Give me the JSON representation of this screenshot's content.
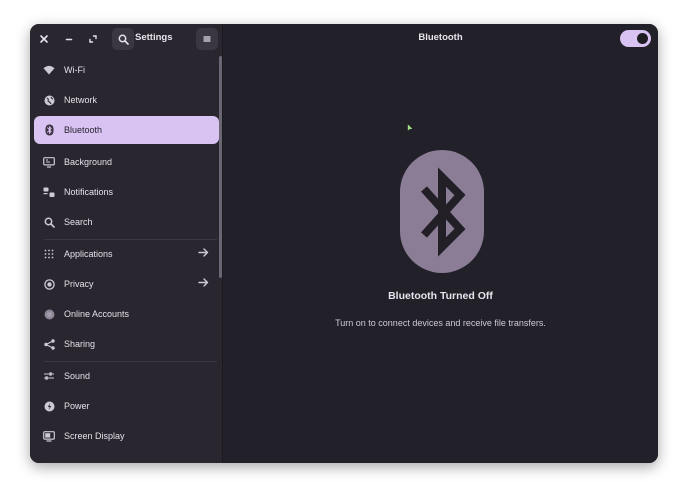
{
  "window": {
    "sidebar_title": "Settings",
    "main_title": "Bluetooth",
    "bluetooth_enabled": false
  },
  "titlebar": {
    "close_icon": "close-icon",
    "minimize_icon": "minimize-icon",
    "maximize_icon": "maximize-icon",
    "search_icon": "search-icon",
    "menu_icon": "hamburger-menu-icon"
  },
  "sidebar": {
    "items": [
      {
        "label": "Wi-Fi",
        "icon": "wifi-icon"
      },
      {
        "label": "Network",
        "icon": "network-globe-icon"
      },
      {
        "label": "Bluetooth",
        "icon": "bluetooth-icon",
        "active": true
      },
      {
        "label": "Background",
        "icon": "background-monitor-icon"
      },
      {
        "label": "Notifications",
        "icon": "notifications-icon"
      },
      {
        "label": "Search",
        "icon": "search-icon"
      },
      {
        "label": "Applications",
        "icon": "applications-grid-icon",
        "has_arrow": true
      },
      {
        "label": "Privacy",
        "icon": "privacy-icon",
        "has_arrow": true
      },
      {
        "label": "Online Accounts",
        "icon": "online-accounts-icon"
      },
      {
        "label": "Sharing",
        "icon": "sharing-icon"
      },
      {
        "label": "Sound",
        "icon": "sound-icon"
      },
      {
        "label": "Power",
        "icon": "power-icon"
      },
      {
        "label": "Screen Display",
        "icon": "screen-display-icon"
      }
    ]
  },
  "main": {
    "status_title": "Bluetooth Turned Off",
    "status_description": "Turn on to connect devices and receive file transfers."
  },
  "colors": {
    "accent": "#d9c3f2",
    "window_bg": "#222028",
    "sidebar_bg": "#29262f",
    "badge": "#8b7d96"
  }
}
